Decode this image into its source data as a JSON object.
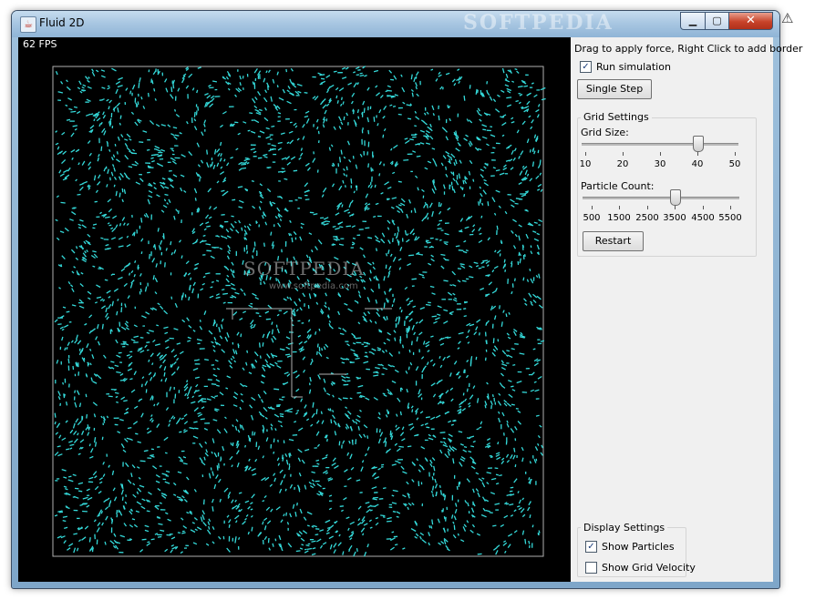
{
  "window": {
    "title": "Fluid 2D",
    "watermark": "SOFTPEDIA"
  },
  "controls": {
    "minimize": "▁",
    "maximize": "▢",
    "close": "✕"
  },
  "simulation": {
    "fps": "62 FPS",
    "watermark_text": "SOFTPEDIA",
    "watermark_url": "www.softpedia.com",
    "particle_color": "#34d9d9",
    "border_color": "#b0b0b0"
  },
  "panel": {
    "hint": "Drag to apply force, Right Click to add border",
    "run_simulation": {
      "label": "Run simulation",
      "checked": true
    },
    "single_step": "Single Step",
    "grid_settings": {
      "title": "Grid Settings",
      "grid_size": {
        "label": "Grid Size:",
        "ticks": [
          "10",
          "20",
          "30",
          "40",
          "50"
        ],
        "min": 10,
        "max": 50,
        "value": 40
      },
      "particle_count": {
        "label": "Particle Count:",
        "ticks": [
          "500",
          "1500",
          "2500",
          "3500",
          "4500",
          "5500"
        ],
        "min": 500,
        "max": 5500,
        "value": 3500
      },
      "restart": "Restart"
    },
    "display_settings": {
      "title": "Display Settings",
      "show_particles": {
        "label": "Show Particles",
        "checked": true
      },
      "show_grid_velocity": {
        "label": "Show Grid Velocity",
        "checked": false
      }
    }
  }
}
